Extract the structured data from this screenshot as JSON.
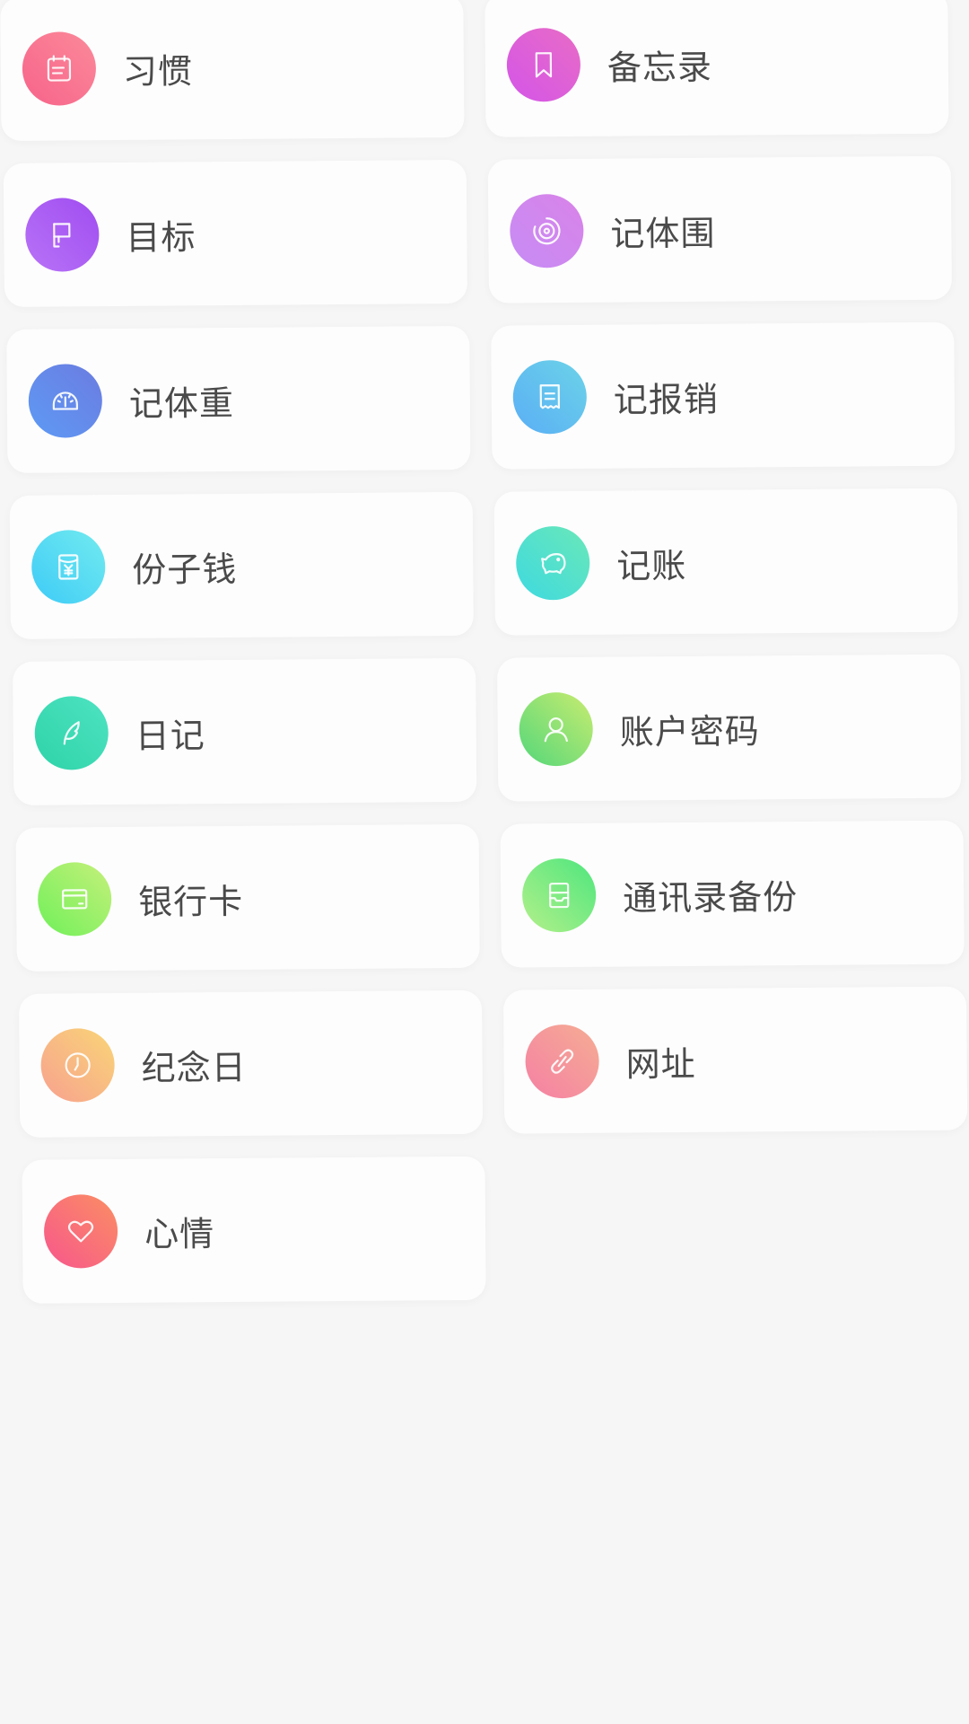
{
  "items": [
    {
      "label": "习惯",
      "icon": "calendar-icon",
      "colors": [
        "#f7638a",
        "#fb8a9a"
      ]
    },
    {
      "label": "备忘录",
      "icon": "bookmark-icon",
      "colors": [
        "#d455e8",
        "#e86cc6"
      ]
    },
    {
      "label": "目标",
      "icon": "flag-icon",
      "colors": [
        "#b873f7",
        "#a04df0"
      ]
    },
    {
      "label": "记体围",
      "icon": "target-circle-icon",
      "colors": [
        "#c68cf5",
        "#d983e8"
      ]
    },
    {
      "label": "记体重",
      "icon": "gauge-icon",
      "colors": [
        "#5e9af5",
        "#6b7ce0"
      ]
    },
    {
      "label": "记报销",
      "icon": "receipt-icon",
      "colors": [
        "#5aaef5",
        "#6cd3e8"
      ]
    },
    {
      "label": "份子钱",
      "icon": "red-envelope-icon",
      "colors": [
        "#3ecbf7",
        "#72ebef"
      ]
    },
    {
      "label": "记账",
      "icon": "piggy-bank-icon",
      "colors": [
        "#3ed9e0",
        "#6ae8b8"
      ]
    },
    {
      "label": "日记",
      "icon": "feather-icon",
      "colors": [
        "#2ed3a8",
        "#4ee3c2"
      ]
    },
    {
      "label": "账户密码",
      "icon": "user-icon",
      "colors": [
        "#53d77a",
        "#c9ec70"
      ]
    },
    {
      "label": "银行卡",
      "icon": "bank-card-icon",
      "colors": [
        "#6ff05a",
        "#c6f07a"
      ]
    },
    {
      "label": "通讯录备份",
      "icon": "contacts-box-icon",
      "colors": [
        "#b4f08a",
        "#4ee67e"
      ]
    },
    {
      "label": "纪念日",
      "icon": "clock-icon",
      "colors": [
        "#f8a18f",
        "#f9d577"
      ]
    },
    {
      "label": "网址",
      "icon": "link-icon",
      "colors": [
        "#f580a4",
        "#f5ad93"
      ]
    },
    {
      "label": "心情",
      "icon": "heart-icon",
      "colors": [
        "#f7568c",
        "#fb8f63"
      ]
    }
  ]
}
